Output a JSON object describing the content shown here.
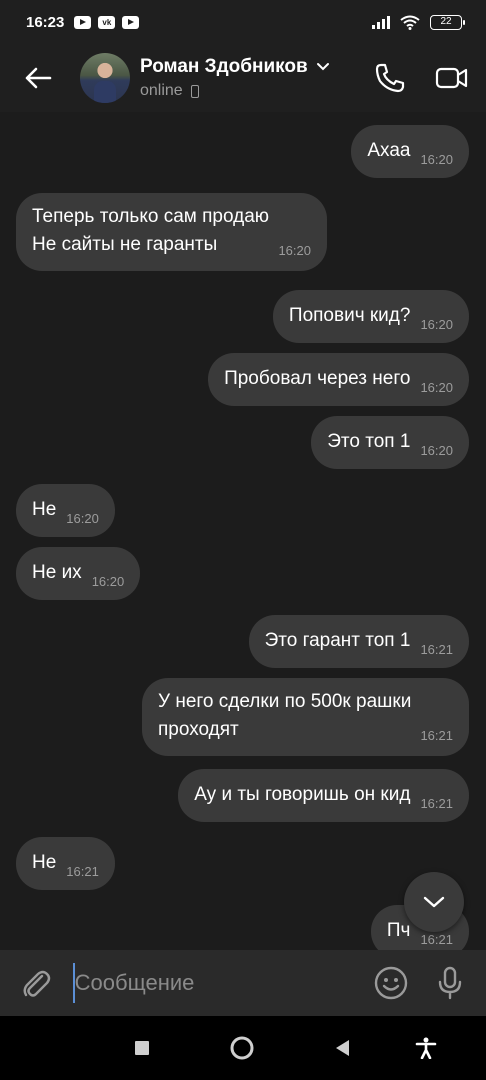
{
  "status_bar": {
    "time": "16:23",
    "battery": "22"
  },
  "header": {
    "contact_name": "Роман Здобников",
    "contact_status": "online"
  },
  "messages": [
    {
      "text": "Ахаа",
      "time": "16:20",
      "side": "out"
    },
    {
      "text": "Теперь только сам продаю\nНе сайты не гаранты",
      "time": "16:20",
      "side": "in"
    },
    {
      "text": "Попович кид?",
      "time": "16:20",
      "side": "out"
    },
    {
      "text": "Пробовал через него",
      "time": "16:20",
      "side": "out"
    },
    {
      "text": "Это топ 1",
      "time": "16:20",
      "side": "out"
    },
    {
      "text": "Не",
      "time": "16:20",
      "side": "in"
    },
    {
      "text": "Не их",
      "time": "16:20",
      "side": "in"
    },
    {
      "text": "Это гарант топ 1",
      "time": "16:21",
      "side": "out"
    },
    {
      "text": "У него сделки по 500к рашки\nпроходят",
      "time": "16:21",
      "side": "out"
    },
    {
      "text": "Ау и ты говоришь он кид",
      "time": "16:21",
      "side": "out"
    },
    {
      "text": "Не",
      "time": "16:21",
      "side": "in"
    },
    {
      "text": "Пч",
      "time": "16:21",
      "side": "out"
    }
  ],
  "composer": {
    "placeholder": "Сообщение"
  },
  "colors": {
    "background": "#1c1c1c",
    "bubble": "#3a3a3a",
    "accent": "#5b8fd6"
  }
}
